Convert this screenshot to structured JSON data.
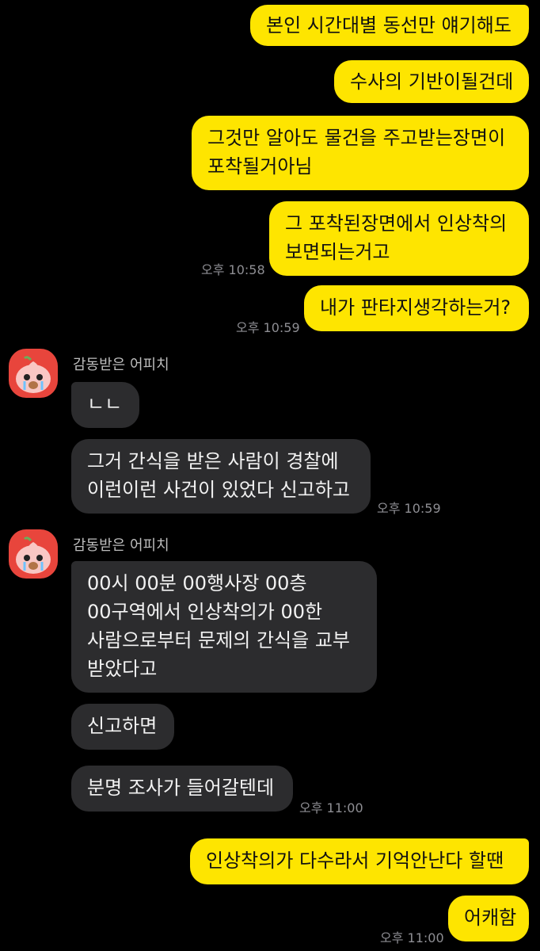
{
  "chat": {
    "outgoing_1": {
      "text": "본인 시간대별 동선만 얘기해도"
    },
    "outgoing_2": {
      "text": "수사의 기반이될건데"
    },
    "outgoing_3": {
      "lines": [
        "그것만 알아도 물건을 주고받는장면이",
        "포착될거아님"
      ]
    },
    "outgoing_4": {
      "lines": [
        "그 포착된장면에서 인상착의",
        "보면되는거고"
      ],
      "time": "오후 10:58"
    },
    "outgoing_5": {
      "text": "내가 판타지생각하는거?",
      "time": "오후 10:59"
    },
    "group_1": {
      "sender": "감동받은 어피치",
      "msg_1": "ㄴㄴ",
      "msg_2_lines": [
        "그거 간식을 받은 사람이 경찰에",
        "이런이런 사건이 있었다 신고하고"
      ],
      "time": "오후 10:59"
    },
    "group_2": {
      "sender": "감동받은 어피치",
      "msg_1_lines": [
        "00시 00분 00행사장 00층",
        "00구역에서 인상착의가 00한",
        "사람으로부터 문제의 간식을 교부",
        "받았다고"
      ],
      "msg_2": "신고하면",
      "msg_3": "분명 조사가 들어갈텐데",
      "time": "오후 11:00"
    },
    "outgoing_6": {
      "text": "인상착의가 다수라서 기억안난다 할땐"
    },
    "outgoing_7": {
      "text": "어캐함",
      "time": "오후 11:00"
    }
  },
  "colors": {
    "background": "#000000",
    "outgoing_bubble": "#FEE500",
    "incoming_bubble": "#2C2C2E",
    "timestamp": "#8E8E93",
    "avatar_bg": "#E8453C"
  },
  "icons": {
    "avatar": "apeach-crying-avatar-icon"
  }
}
